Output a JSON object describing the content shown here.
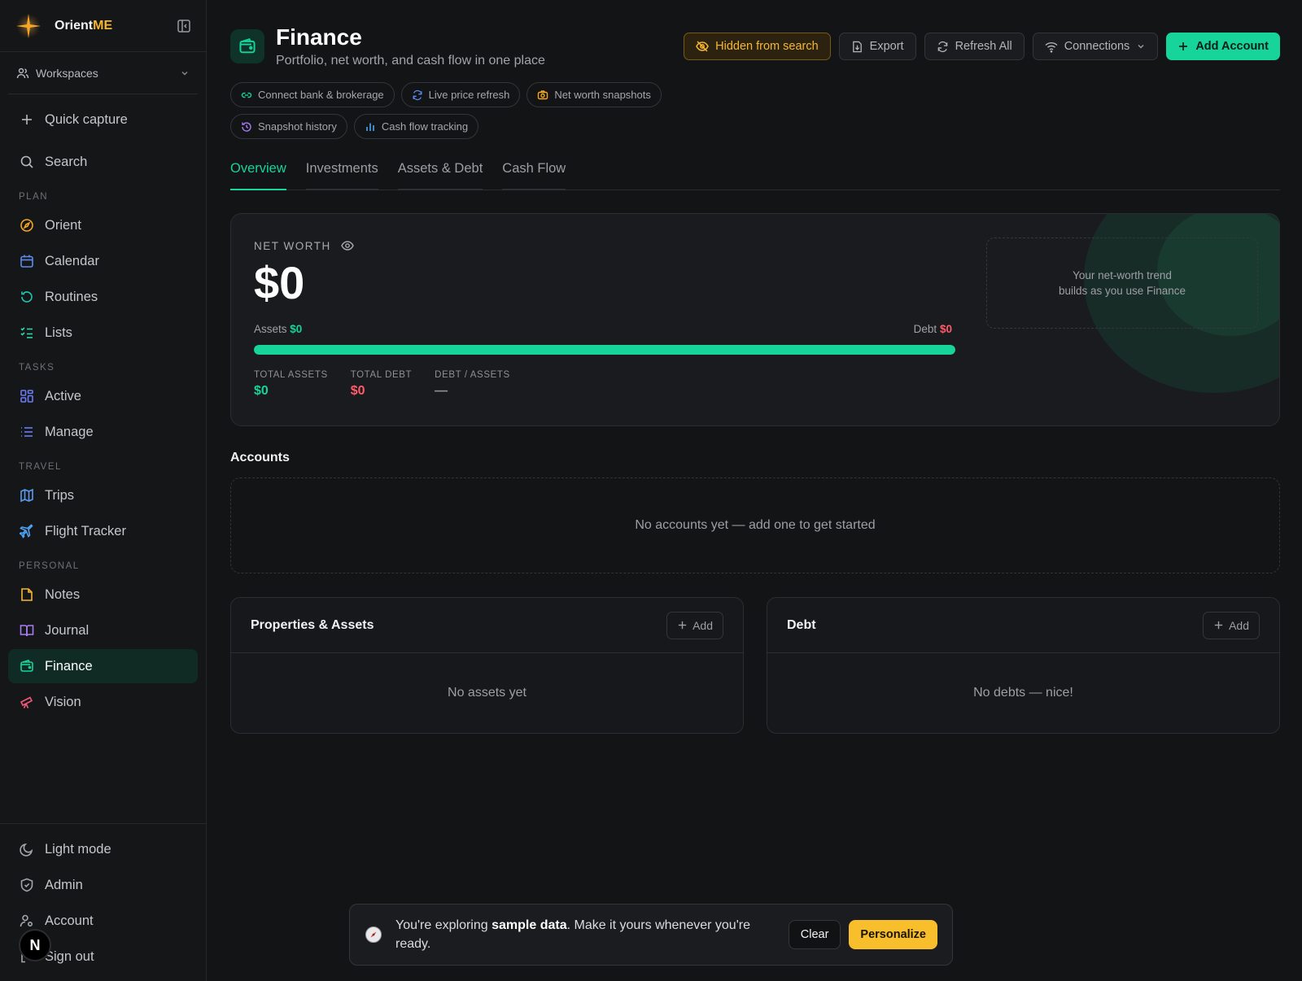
{
  "app": {
    "brand_main": "Orient",
    "brand_accent": "ME",
    "accent_color": "#16d49a"
  },
  "sidebar": {
    "workspace_label": "Workspaces",
    "quick_capture": "Quick capture",
    "search": "Search",
    "sections": {
      "plan": "PLAN",
      "tasks": "TASKS",
      "travel": "TRAVEL",
      "personal": "PERSONAL"
    },
    "items": {
      "orient": "Orient",
      "calendar": "Calendar",
      "routines": "Routines",
      "lists": "Lists",
      "active": "Active",
      "manage": "Manage",
      "trips": "Trips",
      "flight_tracker": "Flight Tracker",
      "notes": "Notes",
      "journal": "Journal",
      "finance": "Finance",
      "vision": "Vision"
    },
    "bottom": {
      "light_mode": "Light mode",
      "admin": "Admin",
      "account": "Account",
      "sign_out": "Sign out",
      "avatar_letter": "N"
    }
  },
  "header": {
    "title": "Finance",
    "subtitle": "Portfolio, net worth, and cash flow in one place",
    "actions": {
      "hidden": "Hidden from search",
      "export": "Export",
      "refresh": "Refresh All",
      "connections": "Connections",
      "add_account": "Add Account"
    },
    "chips": {
      "connect": "Connect bank & brokerage",
      "live_price": "Live price refresh",
      "snapshots": "Net worth snapshots",
      "history": "Snapshot history",
      "cash_flow": "Cash flow tracking"
    }
  },
  "tabs": {
    "overview": "Overview",
    "investments": "Investments",
    "assets_debt": "Assets & Debt",
    "cash_flow": "Cash Flow"
  },
  "net_worth": {
    "label": "NET WORTH",
    "value": "$0",
    "assets_label": "Assets",
    "assets_value": "$0",
    "debt_label": "Debt",
    "debt_value": "$0",
    "asset_share": 1.0,
    "total_assets_label": "TOTAL ASSETS",
    "total_assets_value": "$0",
    "total_debt_label": "TOTAL DEBT",
    "total_debt_value": "$0",
    "ratio_label": "DEBT / ASSETS",
    "ratio_value": "—",
    "trend_line1": "Your net-worth trend",
    "trend_line2": "builds as you use Finance"
  },
  "accounts": {
    "title": "Accounts",
    "empty": "No accounts yet — add one to get started"
  },
  "assets_panel": {
    "title": "Properties & Assets",
    "add": "Add",
    "empty": "No assets yet"
  },
  "debt_panel": {
    "title": "Debt",
    "add": "Add",
    "empty": "No debts — nice!"
  },
  "toast": {
    "prefix": "You're exploring",
    "bold": "sample data",
    "suffix": ". Make it yours whenever you're ready.",
    "clear": "Clear",
    "personalize": "Personalize"
  }
}
